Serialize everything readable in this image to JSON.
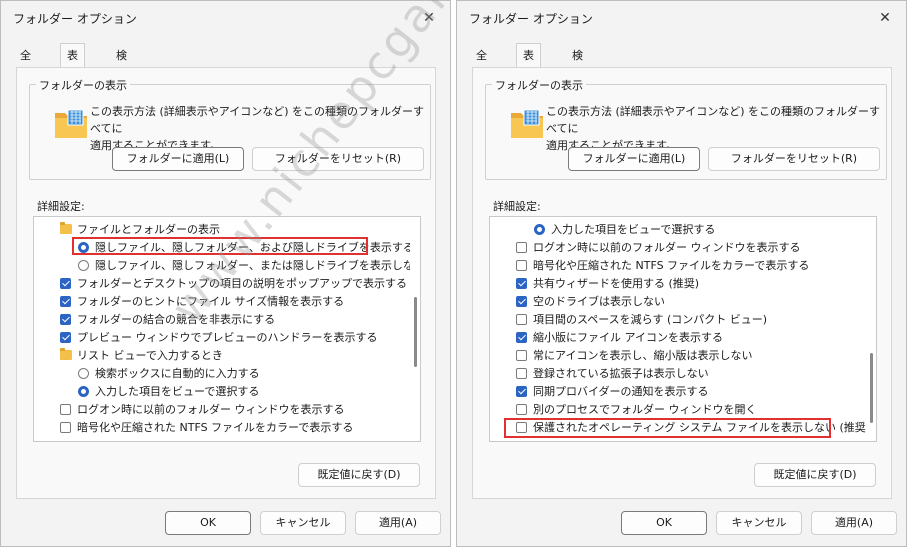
{
  "dialogs": [
    {
      "title": "フォルダー オプション",
      "tabs": [
        "全般",
        "表示",
        "検索"
      ],
      "active_tab": "表示",
      "group_label": "フォルダーの表示",
      "group_text_1": "この表示方法 (詳細表示やアイコンなど) をこの種類のフォルダーすべてに",
      "group_text_2": "適用することができます。",
      "apply_folders": "フォルダーに適用(L)",
      "reset_folders": "フォルダーをリセット(R)",
      "advanced_label": "詳細設定:",
      "restore_defaults": "既定値に戻す(D)",
      "ok": "OK",
      "cancel": "キャンセル",
      "apply": "適用(A)",
      "rows": [
        {
          "type": "folder",
          "indent": 1,
          "text": "ファイルとフォルダーの表示"
        },
        {
          "type": "radio",
          "indent": 2,
          "checked": true,
          "text": "隠しファイル、隠しフォルダー、および隠しドライブを表示する"
        },
        {
          "type": "radio",
          "indent": 2,
          "checked": false,
          "text": "隠しファイル、隠しフォルダー、または隠しドライブを表示しない"
        },
        {
          "type": "check",
          "indent": 1,
          "checked": true,
          "text": "フォルダーとデスクトップの項目の説明をポップアップで表示する"
        },
        {
          "type": "check",
          "indent": 1,
          "checked": true,
          "text": "フォルダーのヒントにファイル サイズ情報を表示する"
        },
        {
          "type": "check",
          "indent": 1,
          "checked": true,
          "text": "フォルダーの結合の競合を非表示にする"
        },
        {
          "type": "check",
          "indent": 1,
          "checked": true,
          "text": "プレビュー ウィンドウでプレビューのハンドラーを表示する"
        },
        {
          "type": "folder",
          "indent": 1,
          "text": "リスト ビューで入力するとき"
        },
        {
          "type": "radio",
          "indent": 2,
          "checked": false,
          "text": "検索ボックスに自動的に入力する"
        },
        {
          "type": "radio",
          "indent": 2,
          "checked": true,
          "text": "入力した項目をビューで選択する"
        },
        {
          "type": "check",
          "indent": 1,
          "checked": false,
          "text": "ログオン時に以前のフォルダー ウィンドウを表示する"
        },
        {
          "type": "check",
          "indent": 1,
          "checked": false,
          "text": "暗号化や圧縮された NTFS ファイルをカラーで表示する"
        }
      ]
    },
    {
      "title": "フォルダー オプション",
      "tabs": [
        "全般",
        "表示",
        "検索"
      ],
      "active_tab": "表示",
      "group_label": "フォルダーの表示",
      "group_text_1": "この表示方法 (詳細表示やアイコンなど) をこの種類のフォルダーすべてに",
      "group_text_2": "適用することができます。",
      "apply_folders": "フォルダーに適用(L)",
      "reset_folders": "フォルダーをリセット(R)",
      "advanced_label": "詳細設定:",
      "restore_defaults": "既定値に戻す(D)",
      "ok": "OK",
      "cancel": "キャンセル",
      "apply": "適用(A)",
      "rows": [
        {
          "type": "radio",
          "indent": 2,
          "checked": true,
          "text": "入力した項目をビューで選択する"
        },
        {
          "type": "check",
          "indent": 1,
          "checked": false,
          "text": "ログオン時に以前のフォルダー ウィンドウを表示する"
        },
        {
          "type": "check",
          "indent": 1,
          "checked": false,
          "text": "暗号化や圧縮された NTFS ファイルをカラーで表示する"
        },
        {
          "type": "check",
          "indent": 1,
          "checked": true,
          "text": "共有ウィザードを使用する (推奨)"
        },
        {
          "type": "check",
          "indent": 1,
          "checked": true,
          "text": "空のドライブは表示しない"
        },
        {
          "type": "check",
          "indent": 1,
          "checked": false,
          "text": "項目間のスペースを減らす (コンパクト ビュー)"
        },
        {
          "type": "check",
          "indent": 1,
          "checked": true,
          "text": "縮小版にファイル アイコンを表示する"
        },
        {
          "type": "check",
          "indent": 1,
          "checked": false,
          "text": "常にアイコンを表示し、縮小版は表示しない"
        },
        {
          "type": "check",
          "indent": 1,
          "checked": false,
          "text": "登録されている拡張子は表示しない"
        },
        {
          "type": "check",
          "indent": 1,
          "checked": true,
          "text": "同期プロバイダーの通知を表示する"
        },
        {
          "type": "check",
          "indent": 1,
          "checked": false,
          "text": "別のプロセスでフォルダー ウィンドウを開く"
        },
        {
          "type": "check",
          "indent": 1,
          "checked": false,
          "text": "保護されたオペレーティング システム ファイルを表示しない (推奨)"
        }
      ]
    }
  ],
  "watermark": "www.nichepcgamer.com",
  "colors": {
    "accent": "#2b64c2",
    "highlight": "#e03030",
    "folder": "#f3c04a"
  }
}
